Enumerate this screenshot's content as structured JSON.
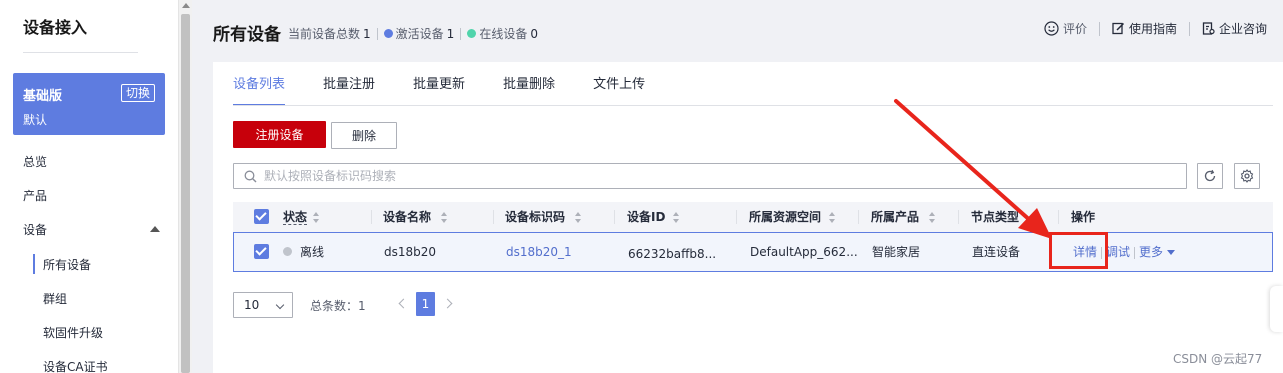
{
  "sidebar": {
    "title": "设备接入",
    "edition": {
      "name": "基础版",
      "switch_label": "切换",
      "sub": "默认"
    },
    "items": [
      {
        "label": "总览"
      },
      {
        "label": "产品"
      },
      {
        "label": "设备"
      }
    ],
    "sub_items": [
      {
        "label": "所有设备"
      },
      {
        "label": "群组"
      },
      {
        "label": "软固件升级"
      },
      {
        "label": "设备CA证书"
      }
    ]
  },
  "header": {
    "title": "所有设备",
    "stats": {
      "total_label": "当前设备总数",
      "total_value": "1",
      "active_label": "激活设备",
      "active_value": "1",
      "online_label": "在线设备",
      "online_value": "0",
      "active_color": "#5e7ce0",
      "online_color": "#50d4ab"
    },
    "actions": {
      "rate": "评价",
      "guide": "使用指南",
      "consult": "企业咨询"
    }
  },
  "tabs": [
    "设备列表",
    "批量注册",
    "批量更新",
    "批量删除",
    "文件上传"
  ],
  "toolbar": {
    "register_label": "注册设备",
    "delete_label": "删除"
  },
  "search": {
    "placeholder": "默认按照设备标识码搜索",
    "value": ""
  },
  "table": {
    "columns": [
      "状态",
      "设备名称",
      "设备标识码",
      "设备ID",
      "所属资源空间",
      "所属产品",
      "节点类型",
      "操作"
    ],
    "rows": [
      {
        "status": "离线",
        "name": "ds18b20",
        "identifier": "ds18b20_1",
        "device_id": "66232baffb8...",
        "resource_space": "DefaultApp_662...",
        "product": "智能家居",
        "node_type": "直连设备",
        "ops": {
          "detail": "详情",
          "debug": "调试",
          "more": "更多"
        }
      }
    ]
  },
  "pagination": {
    "page_size": "10",
    "total_label": "总条数：1",
    "current_page": "1"
  },
  "watermark": "CSDN @云起77",
  "colors": {
    "accent": "#5e7ce0",
    "primary_button": "#c7000b",
    "annotation": "#e8251c"
  }
}
